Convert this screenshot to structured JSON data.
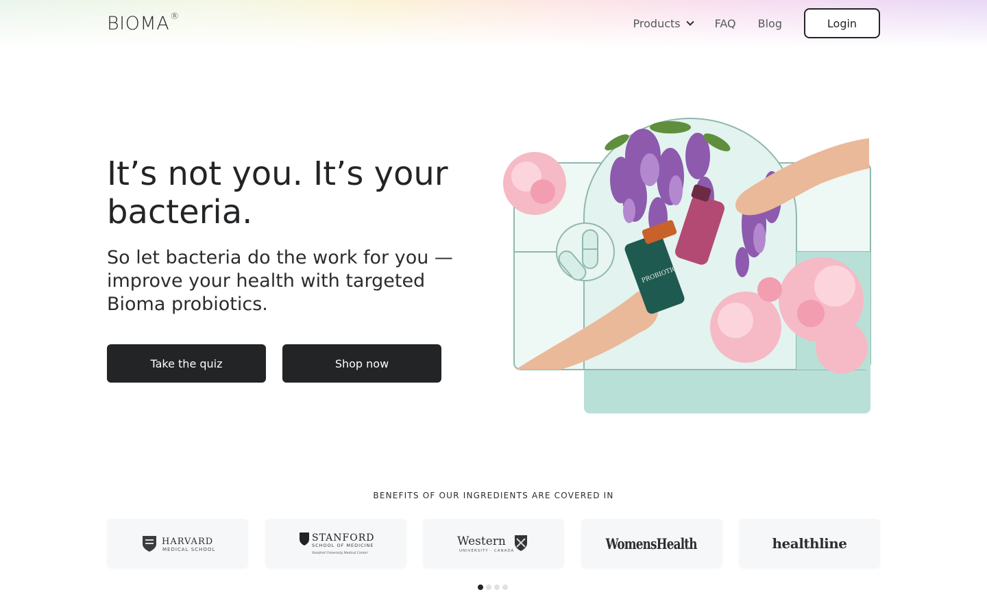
{
  "header": {
    "logo": "BIOMA",
    "logo_mark": "®",
    "nav": {
      "products": "Products",
      "faq": "FAQ",
      "blog": "Blog"
    },
    "login": "Login"
  },
  "hero": {
    "title": "It’s not you. It’s your bacteria.",
    "subtitle": "So let bacteria do the work for you — improve your health with targeted Bioma probiotics.",
    "quiz_button": "Take the quiz",
    "shop_button": "Shop now",
    "bottle_label": "PROBIOTICS"
  },
  "press": {
    "heading": "BENEFITS OF OUR INGREDIENTS ARE COVERED IN",
    "logos": [
      {
        "name": "HARVARD",
        "sub": "MEDICAL SCHOOL"
      },
      {
        "name": "STANFORD",
        "sub": "SCHOOL OF MEDICINE",
        "sub2": "Stanford University Medical Center"
      },
      {
        "name": "Western",
        "sub": "UNIVERSITY · CANADA"
      },
      {
        "name": "WomensHealth"
      },
      {
        "name": "healthline"
      }
    ],
    "carousel_pages": 4,
    "active_page": 1
  },
  "colors": {
    "dark": "#222426",
    "mint": "#b9e0d6",
    "mint_light": "#dff1ec",
    "frame": "#8fb8ad",
    "wisteria": "#8d5aae",
    "peony": "#f6b9c6"
  }
}
